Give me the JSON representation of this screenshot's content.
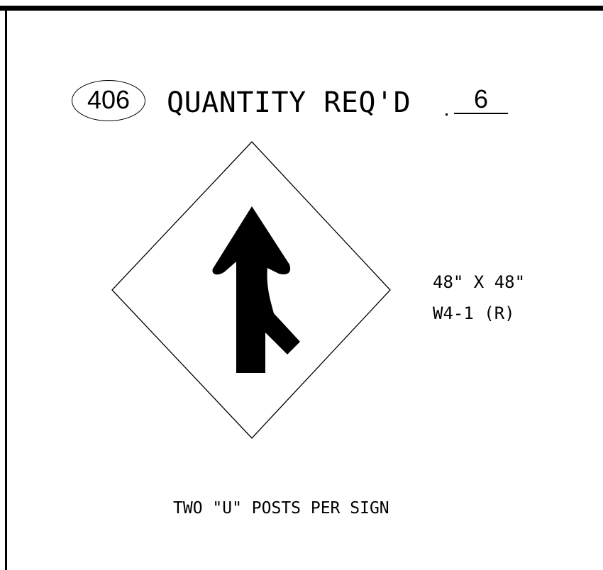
{
  "header": {
    "item_number": "406",
    "quantity_label": "QUANTITY REQ'D",
    "quantity_value": "6"
  },
  "sign": {
    "shape": "diamond",
    "symbol": "merge-arrow-right",
    "size": "48\" X 48\"",
    "code": "W4-1 (R)"
  },
  "note": "TWO \"U\" POSTS PER SIGN"
}
